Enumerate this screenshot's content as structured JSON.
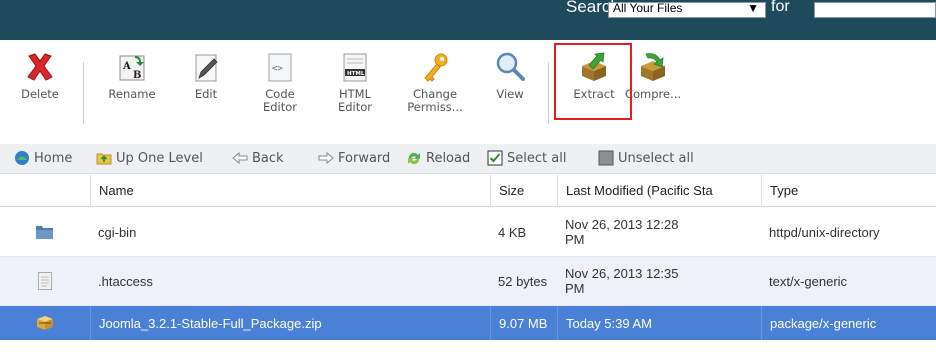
{
  "search": {
    "label": "Search",
    "scope": "All Your Files",
    "for_label": "for",
    "query": ""
  },
  "toolbar": {
    "delete": "Delete",
    "rename": "Rename",
    "edit": "Edit",
    "code_editor_1": "Code",
    "code_editor_2": "Editor",
    "html_editor_1": "HTML",
    "html_editor_2": "Editor",
    "change_perms_1": "Change",
    "change_perms_2": "Permiss...",
    "view": "View",
    "extract": "Extract",
    "compress": "Compre..."
  },
  "nav": {
    "home": "Home",
    "up": "Up One Level",
    "back": "Back",
    "forward": "Forward",
    "reload": "Reload",
    "select_all": "Select all",
    "unselect_all": "Unselect all"
  },
  "table": {
    "headers": {
      "name": "Name",
      "size": "Size",
      "modified": "Last Modified (Pacific Sta",
      "type": "Type"
    },
    "rows": [
      {
        "name": "cgi-bin",
        "size": "4 KB",
        "modified_1": "Nov 26, 2013 12:28",
        "modified_2": "PM",
        "type": "httpd/unix-directory",
        "icon": "folder-icon"
      },
      {
        "name": ".htaccess",
        "size": "52 bytes",
        "modified_1": "Nov 26, 2013 12:35",
        "modified_2": "PM",
        "type": "text/x-generic",
        "icon": "text-file-icon"
      },
      {
        "name": "Joomla_3.2.1-Stable-Full_Package.zip",
        "size": "9.07 MB",
        "modified_1": "Today 5:39 AM",
        "modified_2": "",
        "type": "package/x-generic",
        "icon": "package-icon"
      }
    ]
  },
  "colors": {
    "topbar": "#1e4a5b",
    "selected_row": "#4a81d6",
    "highlight": "#e31e24"
  }
}
